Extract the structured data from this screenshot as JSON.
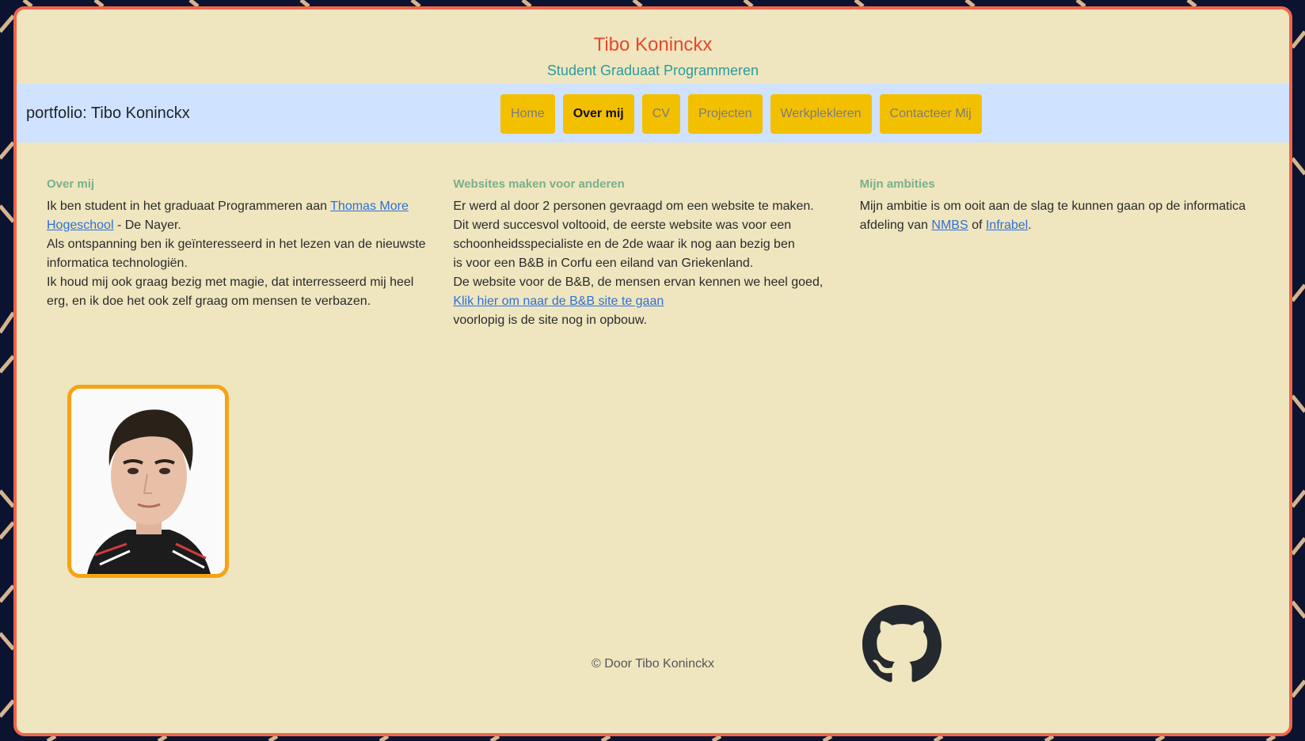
{
  "header": {
    "title": "Tibo Koninckx",
    "subtitle": "Student Graduaat Programmeren"
  },
  "navbar": {
    "brand": "portfolio: Tibo Koninckx",
    "items": [
      {
        "label": "Home"
      },
      {
        "label": "Over mij"
      },
      {
        "label": "CV"
      },
      {
        "label": "Projecten"
      },
      {
        "label": "Werkplekleren"
      },
      {
        "label": "Contacteer Mij"
      }
    ],
    "active": "Over mij"
  },
  "sections": {
    "about": {
      "heading": "Over mij",
      "p1_before": "Ik ben student in het graduaat Programmeren aan ",
      "p1_link": "Thomas More Hogeschool",
      "p1_after": " - De Nayer.",
      "p2": "Als ontspanning ben ik geïnteresseerd in het lezen van de nieuwste informatica technologiën.",
      "p3": "Ik houd mij ook graag bezig met magie, dat interresseerd mij heel erg, en ik doe het ook zelf graag om mensen te verbazen."
    },
    "websites": {
      "heading": "Websites maken voor anderen",
      "l1": "Er werd al door 2 personen gevraagd om een website te maken.",
      "l2": "Dit werd succesvol voltooid, de eerste website was voor een schoonheidsspecialiste en de 2de waar ik nog aan bezig ben",
      "l3": "is voor een B&B in Corfu een eiland van Griekenland.",
      "l4_before": "De website voor de B&B, de mensen ervan kennen we heel goed, ",
      "l4_link": "Klik hier om naar de B&B site te gaan",
      "l5": "voorlopig is de site nog in opbouw."
    },
    "ambitions": {
      "heading": "Mijn ambities",
      "before": "Mijn ambitie is om ooit aan de slag te kunnen gaan op de informatica afdeling van ",
      "link1": "NMBS",
      "middle": " of ",
      "link2": "Infrabel",
      "after": "."
    }
  },
  "footer": {
    "copyright": "© Door Tibo Koninckx"
  },
  "icons": {
    "github": "github-icon"
  },
  "colors": {
    "accent": "#e8472a",
    "subtitle": "#2a9c9c",
    "nav_button": "#f3c000",
    "nav_bar": "#cfe2ff",
    "card_background": "#efe6c0",
    "card_border": "#f0654a",
    "section_heading": "#78b08a",
    "link": "#2f6fd6"
  }
}
